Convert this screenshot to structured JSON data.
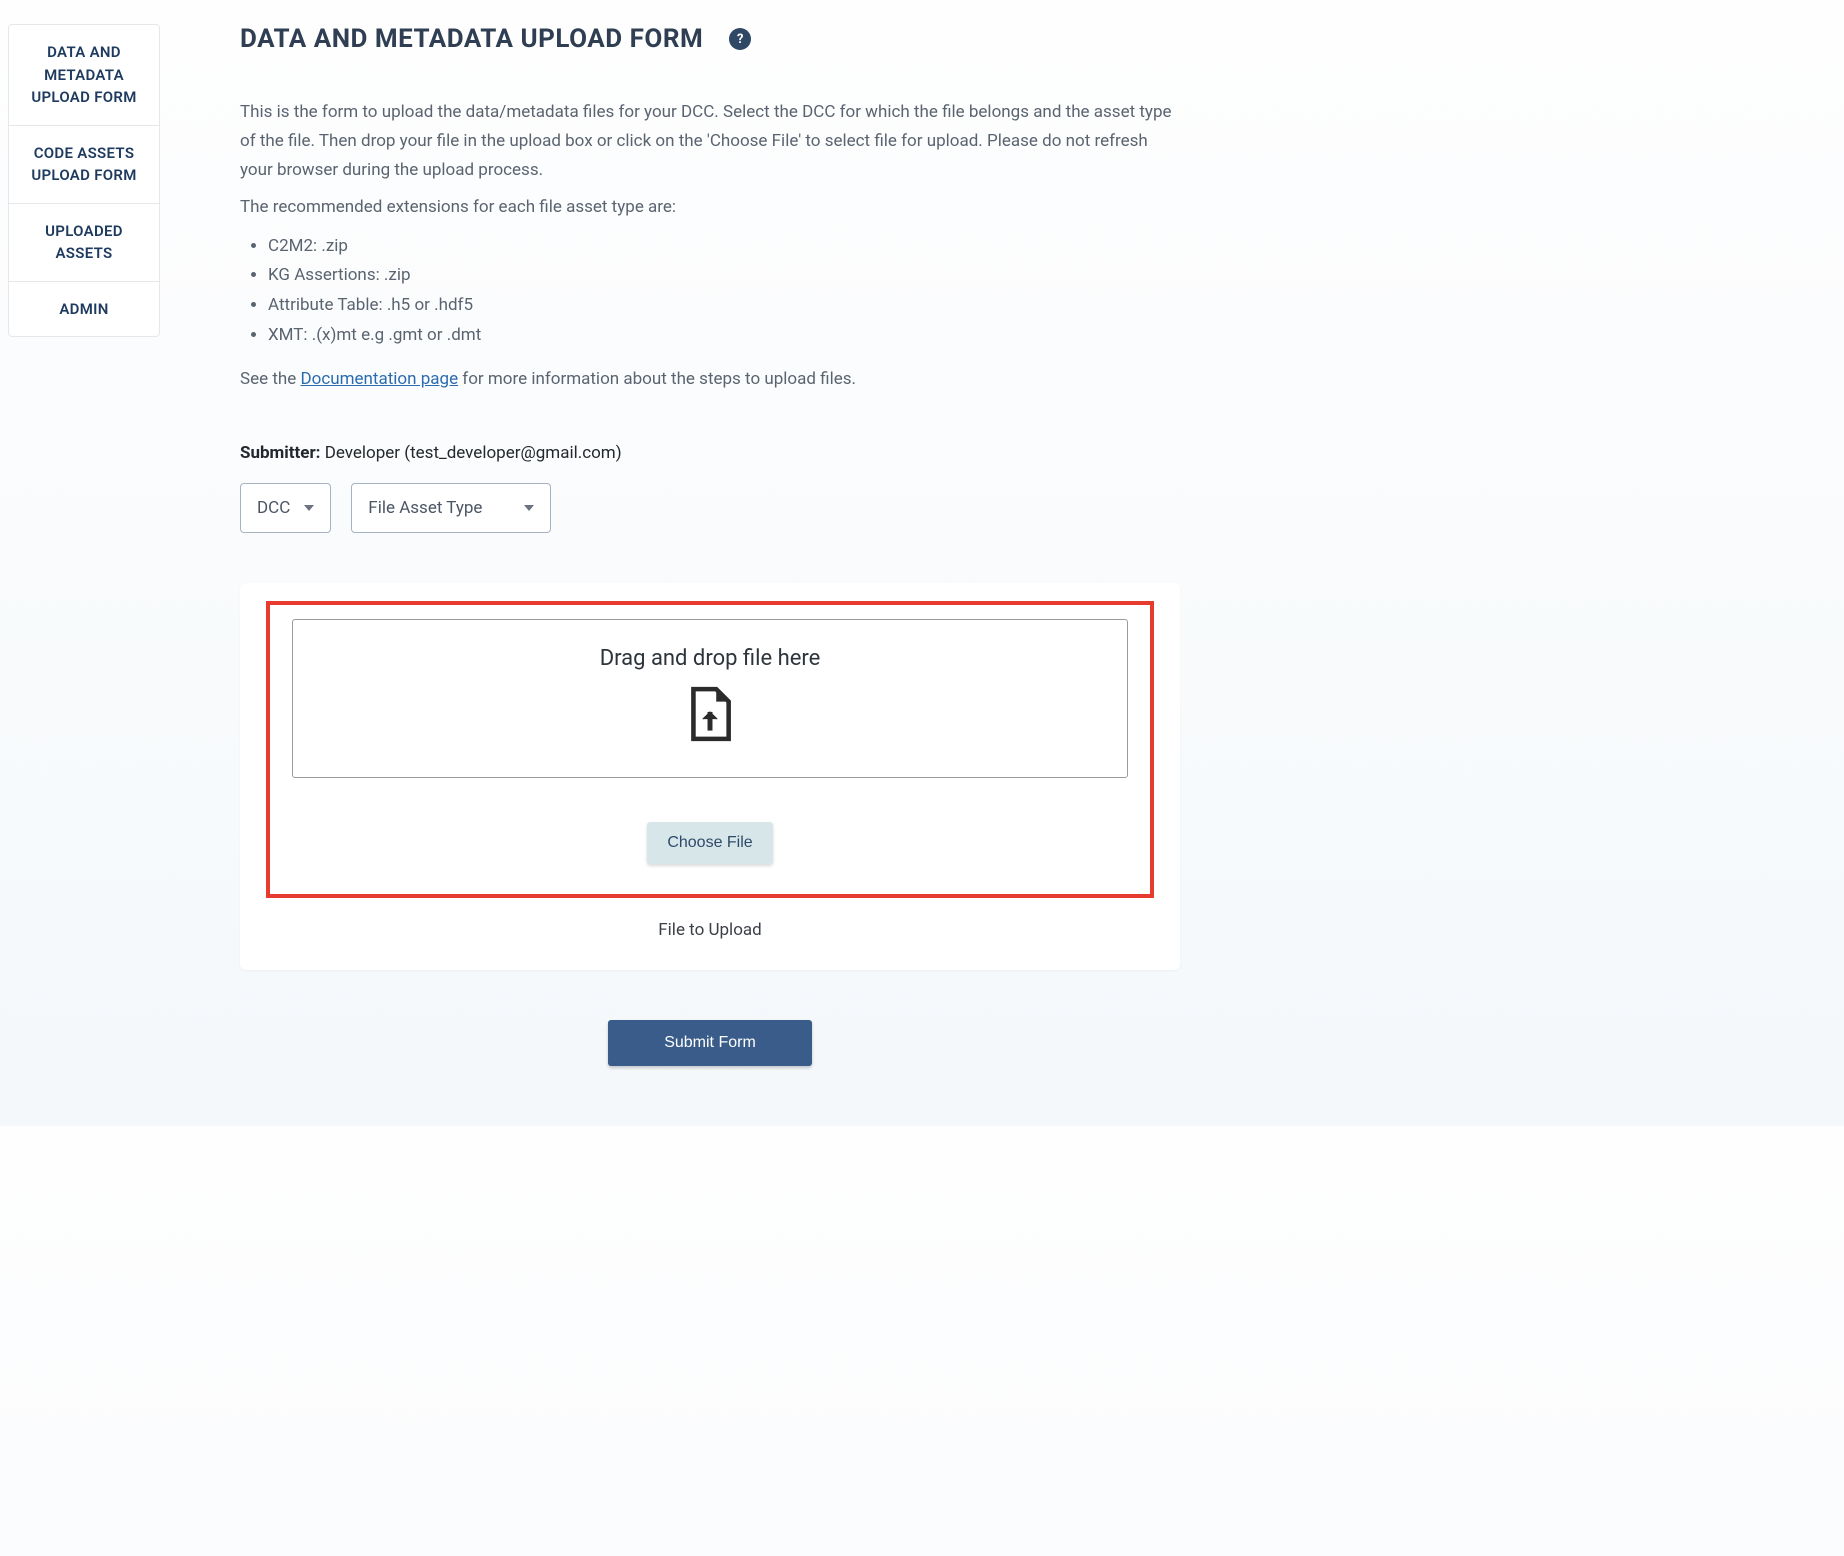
{
  "sidebar": {
    "items": [
      {
        "label": "DATA AND METADATA UPLOAD FORM"
      },
      {
        "label": "CODE ASSETS UPLOAD FORM"
      },
      {
        "label": "UPLOADED ASSETS"
      },
      {
        "label": "ADMIN"
      }
    ]
  },
  "header": {
    "title": "DATA AND METADATA UPLOAD FORM",
    "help_tooltip": "?"
  },
  "description": {
    "intro": "This is the form to upload the data/metadata files for your DCC. Select the DCC for which the file belongs and the asset type of the file. Then drop your file in the upload box or click on the 'Choose File' to select file for upload. Please do not refresh your browser during the upload process.",
    "ext_intro": "The recommended extensions for each file asset type are:",
    "extensions": [
      "C2M2: .zip",
      "KG Assertions: .zip",
      "Attribute Table: .h5 or .hdf5",
      "XMT: .(x)mt e.g .gmt or .dmt"
    ],
    "doc_prefix": "See the ",
    "doc_link_text": "Documentation page",
    "doc_suffix": " for more information about the steps to upload files."
  },
  "submitter": {
    "label": "Submitter:",
    "name": "Developer",
    "email": "test_developer@gmail.com"
  },
  "selects": {
    "dcc_label": "DCC",
    "file_asset_type_label": "File Asset Type"
  },
  "upload": {
    "dropzone_text": "Drag and drop file here",
    "choose_button": "Choose File",
    "file_label": "File to Upload"
  },
  "submit_button": "Submit Form"
}
